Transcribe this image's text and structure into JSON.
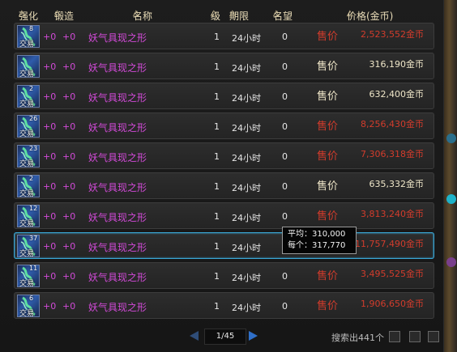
{
  "header": {
    "enhance": "强化",
    "forge": "锻造",
    "name": "名称",
    "level": "级",
    "duration": "期限",
    "fame": "名望",
    "price": "价格(金币)",
    "sort_glyph": "△"
  },
  "rows": [
    {
      "icon_level": "8",
      "trade": "交易",
      "enhance": "+0",
      "forge": "+0",
      "name": "妖气具现之形",
      "level": "1",
      "duration": "24小时",
      "fame": "0",
      "price_label": "售价",
      "price": "2,523,552金币",
      "color": "red"
    },
    {
      "icon_level": "",
      "trade": "交易",
      "enhance": "+0",
      "forge": "+0",
      "name": "妖气具现之形",
      "level": "1",
      "duration": "24小时",
      "fame": "0",
      "price_label": "售价",
      "price": "316,190金币",
      "color": "white"
    },
    {
      "icon_level": "2",
      "trade": "交易",
      "enhance": "+0",
      "forge": "+0",
      "name": "妖气具现之形",
      "level": "1",
      "duration": "24小时",
      "fame": "0",
      "price_label": "售价",
      "price": "632,400金币",
      "color": "white"
    },
    {
      "icon_level": "26",
      "trade": "交易",
      "enhance": "+0",
      "forge": "+0",
      "name": "妖气具现之形",
      "level": "1",
      "duration": "24小时",
      "fame": "0",
      "price_label": "售价",
      "price": "8,256,430金币",
      "color": "red"
    },
    {
      "icon_level": "23",
      "trade": "交易",
      "enhance": "+0",
      "forge": "+0",
      "name": "妖气具现之形",
      "level": "1",
      "duration": "24小时",
      "fame": "0",
      "price_label": "售价",
      "price": "7,306,318金币",
      "color": "red"
    },
    {
      "icon_level": "2",
      "trade": "交易",
      "enhance": "+0",
      "forge": "+0",
      "name": "妖气具现之形",
      "level": "1",
      "duration": "24小时",
      "fame": "0",
      "price_label": "售价",
      "price": "635,332金币",
      "color": "white"
    },
    {
      "icon_level": "12",
      "trade": "交易",
      "enhance": "+0",
      "forge": "+0",
      "name": "妖气具现之形",
      "level": "1",
      "duration": "24小时",
      "fame": "0",
      "price_label": "售价",
      "price": "3,813,240金币",
      "color": "red"
    },
    {
      "icon_level": "37",
      "trade": "交易",
      "enhance": "+0",
      "forge": "+0",
      "name": "妖气具现之形",
      "level": "1",
      "duration": "24小时",
      "fame": "0",
      "price_label": "售价",
      "price": "11,757,490金币",
      "color": "red",
      "selected": true
    },
    {
      "icon_level": "11",
      "trade": "交易",
      "enhance": "+0",
      "forge": "+0",
      "name": "妖气具现之形",
      "level": "1",
      "duration": "24小时",
      "fame": "0",
      "price_label": "售价",
      "price": "3,495,525金币",
      "color": "red"
    },
    {
      "icon_level": "6",
      "trade": "交易",
      "enhance": "+0",
      "forge": "+0",
      "name": "妖气具现之形",
      "level": "1",
      "duration": "24小时",
      "fame": "0",
      "price_label": "售价",
      "price": "1,906,650金币",
      "color": "red"
    }
  ],
  "tooltip": {
    "average_label": "平均：",
    "average": "310,000",
    "each_label": "每个：",
    "each": "317,770"
  },
  "pagination": {
    "page": "1/45",
    "prev_icon": "arrow-left-icon",
    "next_icon": "arrow-right-icon"
  },
  "search_result": "搜索出441个",
  "colors": {
    "name_purple": "#d24ad8",
    "price_red": "#d23c2c",
    "price_white": "#efe6c8",
    "selected_border": "#3aa7d6"
  }
}
